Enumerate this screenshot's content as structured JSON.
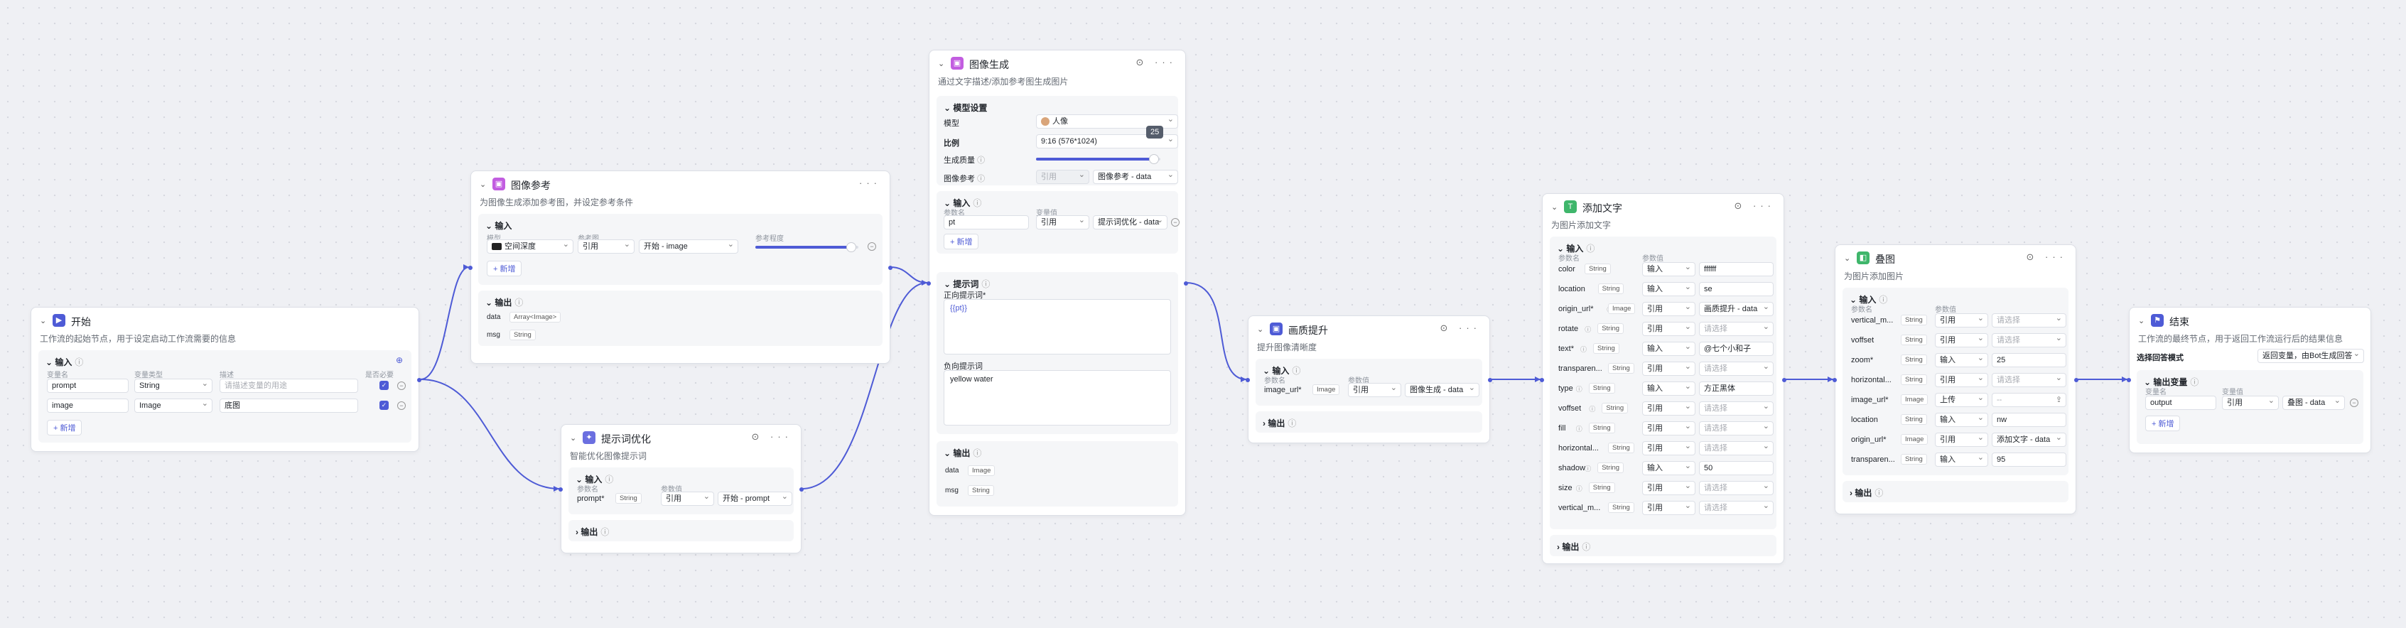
{
  "start": {
    "title": "开始",
    "desc": "工作流的起始节点，用于设定启动工作流需要的信息",
    "input_section": "输入",
    "cols": {
      "name": "变量名",
      "type": "变量类型",
      "desc": "描述",
      "required": "是否必要"
    },
    "rows": [
      {
        "name": "prompt",
        "type": "String",
        "desc": "请描述变量的用途",
        "desc_placeholder": true
      },
      {
        "name": "image",
        "type": "Image",
        "desc": "底图",
        "desc_placeholder": false
      }
    ],
    "add": "新增"
  },
  "imgref": {
    "title": "图像参考",
    "desc": "为图像生成添加参考图，并设定参考条件",
    "input_section": "输入",
    "cols": {
      "model": "模型",
      "ref": "参考图",
      "degree": "参考程度"
    },
    "model_value": "空间深度",
    "ref_mode": "引用",
    "ref_value": "开始 - image",
    "add": "新增",
    "output_section": "输出",
    "outputs": [
      {
        "name": "data",
        "type": "Array<Image>"
      },
      {
        "name": "msg",
        "type": "String"
      }
    ],
    "degree": 0.93
  },
  "promptopt": {
    "title": "提示词优化",
    "desc": "智能优化图像提示词",
    "input_section": "输入",
    "cols": {
      "name": "参数名",
      "value": "参数值"
    },
    "row": {
      "name": "prompt*",
      "type": "String",
      "mode": "引用",
      "value": "开始 - prompt"
    },
    "output_section": "输出"
  },
  "imggen": {
    "title": "图像生成",
    "desc": "通过文字描述/添加参考图生成图片",
    "model_section": "模型设置",
    "model_label": "模型",
    "model_value": "人像",
    "ratio_label": "比例",
    "ratio_value": "9:16 (576*1024)",
    "quality_label": "生成质量",
    "quality_value": "25",
    "quality": 0.95,
    "ref_label": "图像参考",
    "ref_mode": "引用",
    "ref_value": "图像参考 - data",
    "input_section": "输入",
    "cols": {
      "name": "参数名",
      "value": "变量值"
    },
    "input_row": {
      "name": "pt",
      "mode": "引用",
      "value": "提示词优化 - data"
    },
    "add": "新增",
    "prompt_section": "提示词",
    "pos_label": "正向提示词*",
    "pos_value": "{{pt}}",
    "neg_label": "负向提示词",
    "neg_value": "yellow water",
    "output_section": "输出",
    "outputs": [
      {
        "name": "data",
        "type": "Image"
      },
      {
        "name": "msg",
        "type": "String"
      }
    ]
  },
  "enhance": {
    "title": "画质提升",
    "desc": "提升图像清晰度",
    "input_section": "输入",
    "cols": {
      "name": "参数名",
      "value": "参数值"
    },
    "row": {
      "name": "image_url*",
      "type": "Image",
      "mode": "引用",
      "value": "图像生成 - data"
    },
    "output_section": "输出"
  },
  "addtext": {
    "title": "添加文字",
    "desc": "为图片添加文字",
    "input_section": "输入",
    "cols": {
      "name": "参数名",
      "value": "参数值"
    },
    "rows": [
      {
        "name": "color",
        "type": "String",
        "mode": "输入",
        "value": "ffffff",
        "ph": false,
        "info": false
      },
      {
        "name": "location",
        "type": "String",
        "mode": "输入",
        "value": "se",
        "ph": false,
        "info": false
      },
      {
        "name": "origin_url*",
        "type": "Image",
        "mode": "引用",
        "value": "画质提升 - data",
        "ph": false,
        "info": true
      },
      {
        "name": "rotate",
        "type": "String",
        "mode": "引用",
        "value": "请选择",
        "ph": true,
        "info": true
      },
      {
        "name": "text*",
        "type": "String",
        "mode": "输入",
        "value": "@七个小和子",
        "ph": false,
        "info": true
      },
      {
        "name": "transparen...",
        "type": "String",
        "mode": "引用",
        "value": "请选择",
        "ph": true,
        "info": true
      },
      {
        "name": "type",
        "type": "String",
        "mode": "输入",
        "value": "方正黑体",
        "ph": false,
        "info": true
      },
      {
        "name": "voffset",
        "type": "String",
        "mode": "引用",
        "value": "请选择",
        "ph": true,
        "info": true
      },
      {
        "name": "fill",
        "type": "String",
        "mode": "引用",
        "value": "请选择",
        "ph": true,
        "info": true
      },
      {
        "name": "horizontal...",
        "type": "String",
        "mode": "引用",
        "value": "请选择",
        "ph": true,
        "info": true
      },
      {
        "name": "shadow",
        "type": "String",
        "mode": "输入",
        "value": "50",
        "ph": false,
        "info": true
      },
      {
        "name": "size",
        "type": "String",
        "mode": "引用",
        "value": "请选择",
        "ph": true,
        "info": true
      },
      {
        "name": "vertical_m...",
        "type": "String",
        "mode": "引用",
        "value": "请选择",
        "ph": true,
        "info": true
      }
    ],
    "output_section": "输出"
  },
  "watermark": {
    "title": "叠图",
    "desc": "为图片添加图片",
    "input_section": "输入",
    "cols": {
      "name": "参数名",
      "value": "参数值"
    },
    "rows": [
      {
        "name": "vertical_m...",
        "type": "String",
        "mode": "引用",
        "value": "请选择",
        "ph": true,
        "kind": "dd"
      },
      {
        "name": "voffset",
        "type": "String",
        "mode": "引用",
        "value": "请选择",
        "ph": true,
        "kind": "dd"
      },
      {
        "name": "zoom*",
        "type": "String",
        "mode": "输入",
        "value": "25",
        "ph": false,
        "kind": "inp"
      },
      {
        "name": "horizontal...",
        "type": "String",
        "mode": "引用",
        "value": "请选择",
        "ph": true,
        "kind": "dd"
      },
      {
        "name": "image_url*",
        "type": "Image",
        "mode": "上传",
        "value": "--",
        "ph": true,
        "kind": "upload"
      },
      {
        "name": "location",
        "type": "String",
        "mode": "输入",
        "value": "nw",
        "ph": false,
        "kind": "inp"
      },
      {
        "name": "origin_url*",
        "type": "Image",
        "mode": "引用",
        "value": "添加文字 - data",
        "ph": false,
        "kind": "dd"
      },
      {
        "name": "transparen...",
        "type": "String",
        "mode": "输入",
        "value": "95",
        "ph": false,
        "kind": "inp"
      }
    ],
    "output_section": "输出"
  },
  "end": {
    "title": "结束",
    "desc": "工作流的最终节点，用于返回工作流运行后的结果信息",
    "mode_label": "选择回答模式",
    "mode_value": "返回变量，由Bot生成回答",
    "vars_section": "输出变量",
    "cols": {
      "name": "变量名",
      "value": "变量值"
    },
    "row": {
      "name": "output",
      "mode": "引用",
      "value": "叠图 - data"
    },
    "add": "新增"
  },
  "colors": {
    "accent": "#4e5bd6",
    "edge": "#4e5bd6"
  },
  "icons": {
    "start": "play-icon",
    "imgref": "image-icon",
    "promptopt": "sparkle-icon",
    "imggen": "image-icon",
    "enhance": "image-icon",
    "addtext": "text-icon",
    "watermark": "layers-icon",
    "end": "flag-icon"
  }
}
